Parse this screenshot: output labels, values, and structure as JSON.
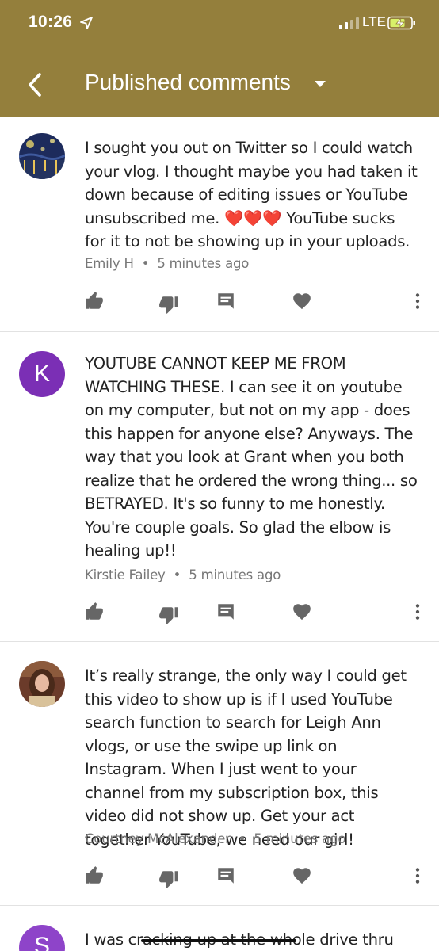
{
  "status_bar": {
    "time": "10:26",
    "network": "LTE"
  },
  "header": {
    "title": "Published comments"
  },
  "comments": [
    {
      "text": "I sought you out on Twitter so I could watch your vlog. I thought maybe you had taken it down because of editing issues or YouTube unsubscribed me. ❤️❤️❤️ YouTube sucks for it to not be showing up in your uploads.",
      "author": "Emily H",
      "time": "5 minutes ago"
    },
    {
      "avatar_letter": "K",
      "text": "YOUTUBE CANNOT KEEP ME FROM WATCHING THESE. I can see it on youtube on my computer, but not on my app - does this happen for anyone else? Anyways. The way that you look at Grant when you both realize that he ordered the wrong thing... so BETRAYED. It's so funny to me honestly. You're couple goals. So glad the elbow is healing up!!",
      "author": "Kirstie Failey",
      "time": "5 minutes ago"
    },
    {
      "text": "It’s really strange, the only way I could get this video to show up is if I used YouTube search function to search for Leigh Ann vlogs, or use the swipe up link on Instagram. When I just went to your channel from my subscription box, this video did not show up. Get your act together YouTube, we need our girl!",
      "author": "Courtney McAlexander",
      "time": "5 minutes ago"
    },
    {
      "avatar_letter": "S",
      "text": "I was cracking up at the whole drive thru"
    }
  ],
  "meta_separator": "•",
  "colors": {
    "header": "#947f3c",
    "avatar_k": "#7b2fb5",
    "avatar_s": "#8e44c9"
  }
}
